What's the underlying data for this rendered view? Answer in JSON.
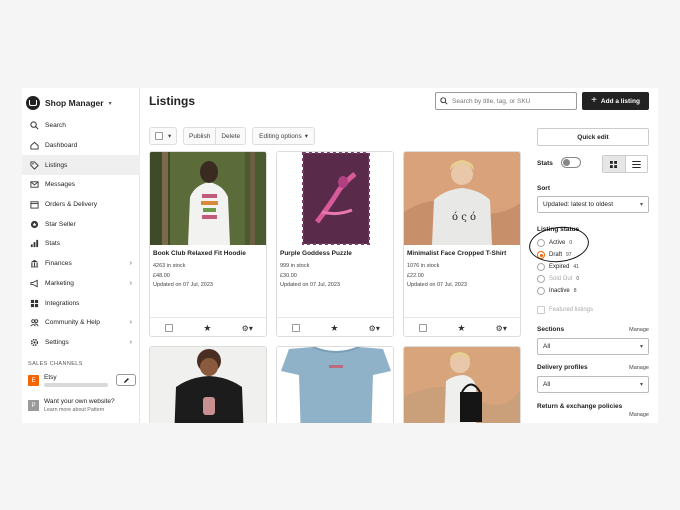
{
  "sidebar": {
    "brand": "Shop Manager",
    "items": [
      {
        "label": "Search",
        "icon": "search-icon"
      },
      {
        "label": "Dashboard",
        "icon": "home-icon"
      },
      {
        "label": "Listings",
        "icon": "tag-icon",
        "active": true
      },
      {
        "label": "Messages",
        "icon": "mail-icon"
      },
      {
        "label": "Orders & Delivery",
        "icon": "box-icon"
      },
      {
        "label": "Star Seller",
        "icon": "star-badge-icon"
      },
      {
        "label": "Stats",
        "icon": "bar-chart-icon"
      },
      {
        "label": "Finances",
        "icon": "bank-icon",
        "chevron": true
      },
      {
        "label": "Marketing",
        "icon": "megaphone-icon",
        "chevron": true
      },
      {
        "label": "Integrations",
        "icon": "grid-icon"
      },
      {
        "label": "Community & Help",
        "icon": "people-icon",
        "chevron": true
      },
      {
        "label": "Settings",
        "icon": "gear-icon",
        "chevron": true
      }
    ],
    "sales_channels_label": "SALES CHANNELS",
    "etsy": {
      "badge": "E",
      "name": "Etsy"
    },
    "website": {
      "badge": "P",
      "title": "Want your own website?",
      "subtitle": "Learn more about Pattern"
    }
  },
  "header": {
    "title": "Listings",
    "search_placeholder": "Search by title, tag, or SKU",
    "add_button": "Add a listing"
  },
  "toolbar": {
    "publish": "Publish",
    "delete": "Delete",
    "editing_options": "Editing options"
  },
  "listings": [
    {
      "name": "Book Club Relaxed Fit Hoodie",
      "stock": "4263 in stock",
      "price": "£48.00",
      "updated": "Updated on 07 Jul, 2023"
    },
    {
      "name": "Purple Goddess Puzzle",
      "stock": "999 in stock",
      "price": "£30.00",
      "updated": "Updated on 07 Jul, 2023"
    },
    {
      "name": "Minimalist Face Cropped T-Shirt",
      "stock": "1076 in stock",
      "price": "£22.00",
      "updated": "Updated on 07 Jul, 2023"
    },
    {
      "name": "",
      "stock": "",
      "price": "",
      "updated": ""
    },
    {
      "name": "",
      "stock": "",
      "price": "",
      "updated": ""
    },
    {
      "name": "",
      "stock": "",
      "price": "",
      "updated": ""
    }
  ],
  "right_panel": {
    "quick_edit": "Quick edit",
    "stats_label": "Stats",
    "sort_label": "Sort",
    "sort_value": "Updated: latest to oldest",
    "status_label": "Listing status",
    "statuses": [
      {
        "label": "Active",
        "count": "0"
      },
      {
        "label": "Draft",
        "count": "97",
        "selected": true
      },
      {
        "label": "Expired",
        "count": "41"
      },
      {
        "label": "Sold Out",
        "count": "0"
      },
      {
        "label": "Inactive",
        "count": "8"
      }
    ],
    "featured": "Featured listings",
    "sections_label": "Sections",
    "sections_manage": "Manage",
    "sections_value": "All",
    "delivery_label": "Delivery profiles",
    "delivery_manage": "Manage",
    "delivery_value": "All",
    "returns_label": "Return & exchange policies",
    "returns_manage": "Manage"
  },
  "colors": {
    "accent": "#f56400",
    "dark_button": "#222222"
  }
}
